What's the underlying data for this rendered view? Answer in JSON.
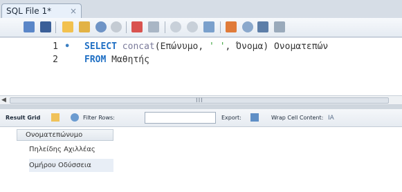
{
  "tab": {
    "title": "SQL File 1*",
    "close": "×"
  },
  "editor": {
    "lines": [
      {
        "number": "1",
        "marker": "•",
        "keyword": "SELECT",
        "fn": "concat",
        "open": "(Επώνυμο, ",
        "str": "' '",
        "rest": ", Όνομα) Ονοματεπών"
      },
      {
        "number": "2",
        "keyword": "FROM",
        "rest": " Μαθητής"
      }
    ]
  },
  "scrollbar": {
    "left_arrow": "◀",
    "grip": "III"
  },
  "result_toolbar": {
    "result_grid": "Result Grid",
    "filter_rows": "Filter Rows:",
    "filter_value": "",
    "export": "Export:",
    "wrap_cell": "Wrap Cell Content:",
    "wrap_icon": "IA"
  },
  "results": {
    "column": "Ονοματεπώνυμο",
    "rows": [
      "Πηλείδης Αχιλλέας",
      "Ομήρου Οδύσσεια"
    ]
  },
  "colors": {
    "keyword": "#1f6fc4",
    "string": "#3aa43a",
    "selected_row": "#e8eef6"
  }
}
